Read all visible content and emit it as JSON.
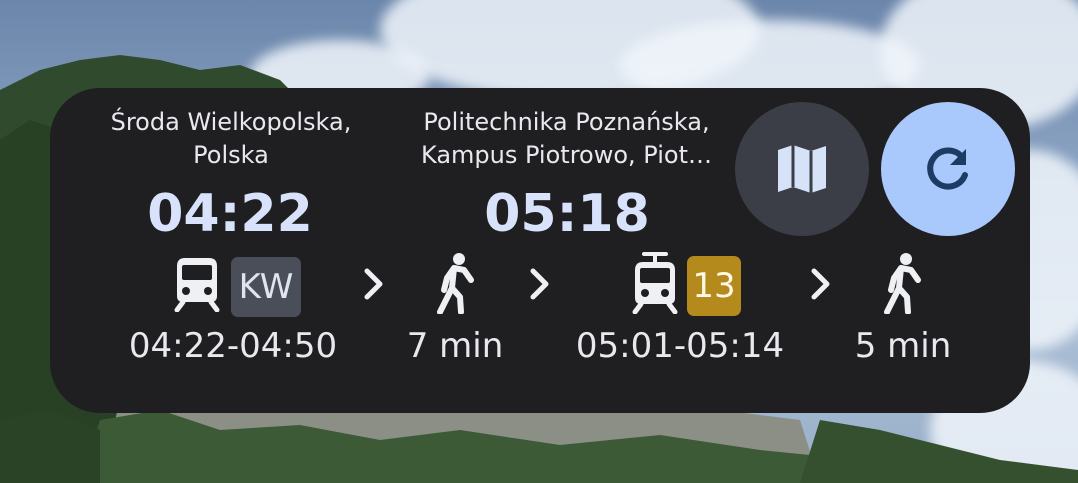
{
  "background": {
    "colors": {
      "sky": "#8aa3c2",
      "forest": "#2f4a2c",
      "rock": "#8b8f86"
    }
  },
  "widget": {
    "origin": {
      "name_line1": "Środa Wielkopolska,",
      "name_line2": "Polska",
      "time": "04:22"
    },
    "destination": {
      "name_line1": "Politechnika Poznańska,",
      "name_line2": "Kampus Piotrowo, Piot…",
      "time": "05:18"
    },
    "buttons": {
      "map_icon": "map-icon",
      "refresh_icon": "refresh-icon"
    },
    "legs": [
      {
        "type": "train",
        "icon": "train-icon",
        "line": "KW",
        "text": "04:22-04:50",
        "badge_color": "#4a4e58"
      },
      {
        "type": "walk",
        "icon": "walk-icon",
        "text": "7 min"
      },
      {
        "type": "tram",
        "icon": "tram-icon",
        "line": "13",
        "text": "05:01-05:14",
        "badge_color": "#b58a1c"
      },
      {
        "type": "walk",
        "icon": "walk-icon",
        "text": "5 min"
      }
    ],
    "separator_icon": "chevron-right-icon",
    "colors": {
      "card": "#1f1f22",
      "time_text": "#d8e3fb",
      "map_button": "#3b3e47",
      "refresh_button": "#a9c8fb"
    }
  }
}
